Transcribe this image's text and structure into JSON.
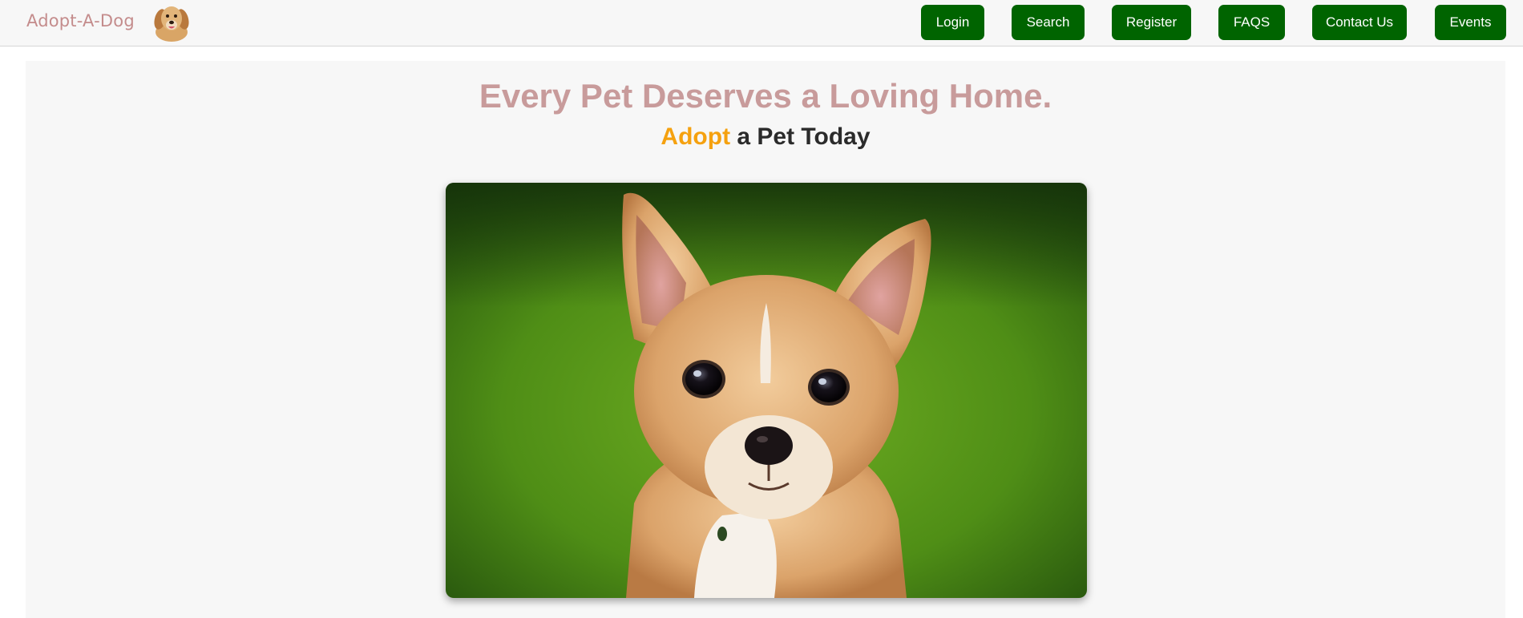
{
  "navbar": {
    "brand": "Adopt-A-Dog",
    "logo_icon": "golden-retriever-icon",
    "buttons": {
      "login": "Login",
      "search": "Search",
      "register": "Register",
      "faqs": "FAQS",
      "contact": "Contact Us",
      "events": "Events"
    },
    "button_color": "#006400"
  },
  "hero": {
    "headline": "Every Pet Deserves a Loving Home.",
    "subheadline_accent": "Adopt",
    "subheadline_rest": " a Pet Today",
    "image": "chihuahua-on-grass-photo",
    "colors": {
      "headline": "#c89b9b",
      "accent": "#f5a10f"
    }
  }
}
